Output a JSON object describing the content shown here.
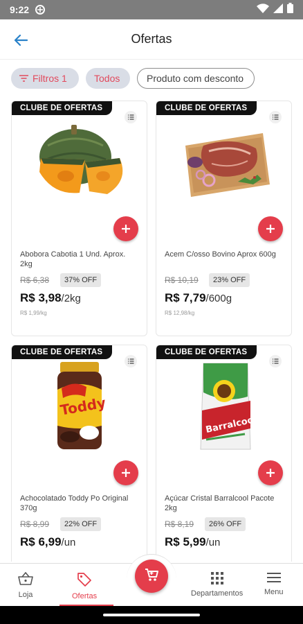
{
  "status": {
    "time": "9:22"
  },
  "header": {
    "title": "Ofertas"
  },
  "chips": {
    "filters": "Filtros 1",
    "all": "Todos",
    "discount": "Produto com desconto"
  },
  "badge": "CLUBE DE OFERTAS",
  "products": [
    {
      "name": "Abobora Cabotia 1 Und. Aprox. 2kg",
      "old_price": "R$ 6,38",
      "off": "37% OFF",
      "price": "R$ 3,98",
      "unit": "/2kg",
      "per_kg": "R$ 1,99/kg",
      "image": "pumpkin"
    },
    {
      "name": "Acem C/osso Bovino Aprox 600g",
      "old_price": "R$ 10,19",
      "off": "23% OFF",
      "price": "R$ 7,79",
      "unit": "/600g",
      "per_kg": "R$ 12,98/kg",
      "image": "beef"
    },
    {
      "name": "Achocolatado Toddy Po Original 370g",
      "old_price": "R$ 8,99",
      "off": "22% OFF",
      "price": "R$ 6,99",
      "unit": "/un",
      "image": "toddy-jar"
    },
    {
      "name": "Açúcar Cristal Barralcool Pacote 2kg",
      "old_price": "R$ 8,19",
      "off": "26% OFF",
      "price": "R$ 5,99",
      "unit": "/un",
      "image": "sugar-bag"
    }
  ],
  "product_image_text": {
    "toddy": "Toddy",
    "barralcool": "Barralcool"
  },
  "nav": {
    "loja": "Loja",
    "ofertas": "Ofertas",
    "departamentos": "Departamentos",
    "menu": "Menu"
  },
  "colors": {
    "accent": "#e43d4b",
    "chip_bg": "#d9dde6",
    "back_arrow": "#2a82c9"
  }
}
